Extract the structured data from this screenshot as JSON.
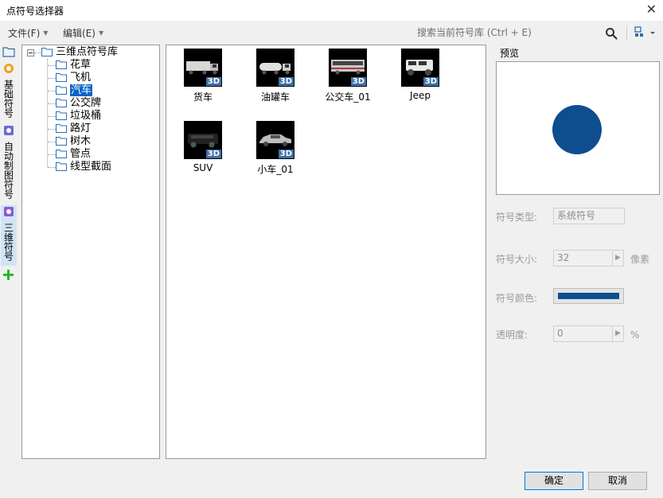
{
  "window": {
    "title": "点符号选择器",
    "close": "✕"
  },
  "menu": {
    "file": "文件(F)",
    "edit": "编辑(E)"
  },
  "search": {
    "placeholder": "搜索当前符号库 (Ctrl + E)"
  },
  "vtabs": [
    {
      "label": "基础符号",
      "icon": "basic-symbol-icon"
    },
    {
      "label": "自动制图符号",
      "icon": "auto-mapping-symbol-icon"
    },
    {
      "label": "三维符号",
      "icon": "3d-symbol-icon",
      "active": true
    },
    {
      "label": "",
      "icon": "add-icon"
    }
  ],
  "tree": {
    "root": "三维点符号库",
    "expander": "−",
    "children": [
      "花草",
      "飞机",
      "汽车",
      "公交牌",
      "垃圾桶",
      "路灯",
      "树木",
      "管点",
      "线型截面"
    ],
    "selected": "汽车"
  },
  "symbols": [
    {
      "name": "货车",
      "badge": "3D",
      "kind": "truck"
    },
    {
      "name": "油罐车",
      "badge": "3D",
      "kind": "tanker"
    },
    {
      "name": "公交车_01",
      "badge": "3D",
      "kind": "bus"
    },
    {
      "name": "Jeep",
      "badge": "3D",
      "kind": "jeep"
    },
    {
      "name": "SUV",
      "badge": "3D",
      "kind": "suv"
    },
    {
      "name": "小车_01",
      "badge": "3D",
      "kind": "car"
    }
  ],
  "preview": {
    "title": "预览",
    "circle_color": "#0e4e8f"
  },
  "props": {
    "type_label": "符号类型:",
    "type_value": "系统符号",
    "size_label": "符号大小:",
    "size_value": "32",
    "size_unit": "像素",
    "color_label": "符号颜色:",
    "color_value": "#0e4e8f",
    "alpha_label": "透明度:",
    "alpha_value": "0",
    "alpha_unit": "%"
  },
  "buttons": {
    "ok": "确定",
    "cancel": "取消"
  }
}
